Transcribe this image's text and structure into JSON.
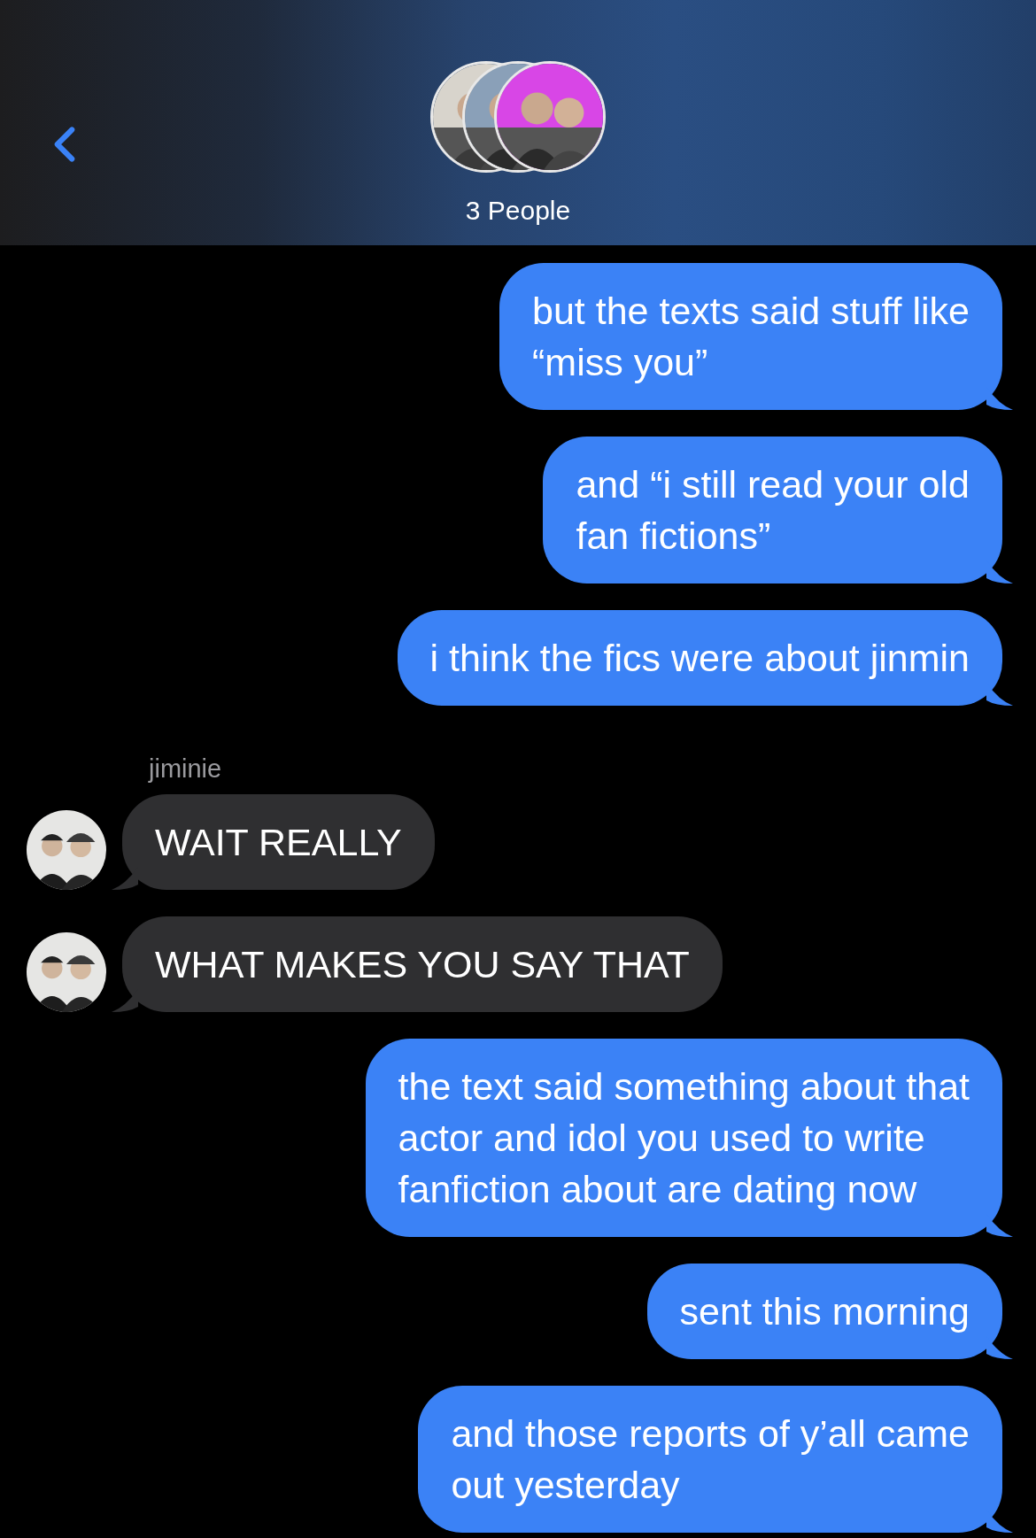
{
  "header": {
    "title": "3 People"
  },
  "messages": [
    {
      "kind": "sent",
      "text": "but the texts said stuff like\n“miss you”"
    },
    {
      "kind": "sent",
      "text": "and “i still read your old\nfan fictions”"
    },
    {
      "kind": "sent",
      "text": "i think the fics were about jinmin"
    },
    {
      "kind": "sender",
      "text": "jiminie"
    },
    {
      "kind": "received",
      "text": "WAIT REALLY"
    },
    {
      "kind": "received",
      "text": "WHAT MAKES YOU SAY THAT"
    },
    {
      "kind": "sent",
      "text": "the text said something about that\nactor and idol you used to write\nfanfiction about are dating now"
    },
    {
      "kind": "sent",
      "text": "sent this morning"
    },
    {
      "kind": "sent",
      "text": "and those reports of y’all came\nout yesterday"
    }
  ]
}
